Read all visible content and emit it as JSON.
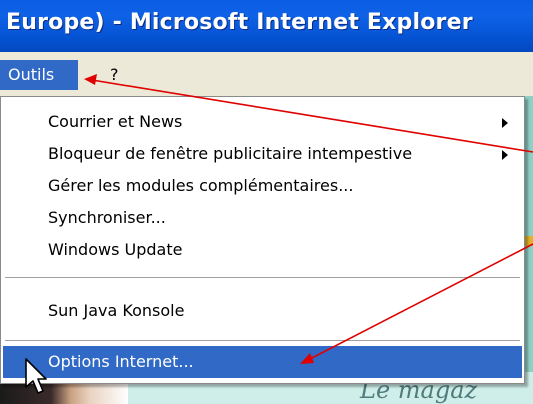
{
  "window": {
    "title": "Europe) - Microsoft Internet Explorer"
  },
  "menubar": {
    "outils": "Outils",
    "help": "?"
  },
  "dropdown": {
    "items": [
      {
        "label": "Courrier et News",
        "submenu": true
      },
      {
        "label": "Bloqueur de fenêtre publicitaire intempestive",
        "submenu": true
      },
      {
        "label": "Gérer les modules complémentaires...",
        "submenu": false
      },
      {
        "label": "Synchroniser...",
        "submenu": false
      },
      {
        "label": "Windows Update",
        "submenu": false
      },
      {
        "label": "Sun Java Konsole",
        "submenu": false
      },
      {
        "label": "Options Internet...",
        "submenu": false,
        "highlighted": true
      }
    ]
  },
  "background": {
    "text": "Le magaz"
  },
  "colors": {
    "titlebar": "#0554d4",
    "highlight": "#3169c6",
    "arrow": "#e00000"
  }
}
